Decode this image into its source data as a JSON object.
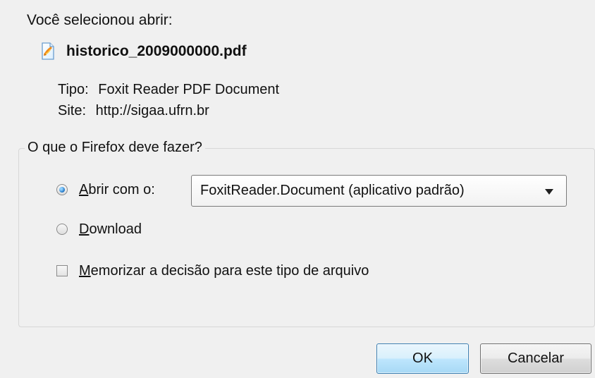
{
  "dialog": {
    "intro_text": "Você selecionou abrir:",
    "file_name": "historico_2009000000.pdf",
    "type_label": "Tipo:",
    "type_value": "Foxit Reader PDF Document",
    "site_label": "Site:",
    "site_value": "http://sigaa.ufrn.br",
    "group_title": "O que o Firefox deve fazer?",
    "open_option": {
      "label_hotkey": "A",
      "label_rest": "brir com o:",
      "selected": true
    },
    "app_select": {
      "value": "FoxitReader.Document (aplicativo padrão)",
      "icon": "chevron-down-icon"
    },
    "download_option": {
      "label_hotkey": "D",
      "label_rest": "ownload",
      "selected": false
    },
    "remember_option": {
      "label_hotkey": "M",
      "label_rest": "emorizar a decisão para este tipo de arquivo",
      "checked": false
    },
    "buttons": {
      "ok": "OK",
      "cancel": "Cancelar"
    },
    "icons": {
      "file": "pdf-file-icon"
    },
    "colors": {
      "background": "#f0f0f0",
      "selected_radio": "#1d71c1",
      "primary_button_border": "#3c7fb1"
    }
  }
}
